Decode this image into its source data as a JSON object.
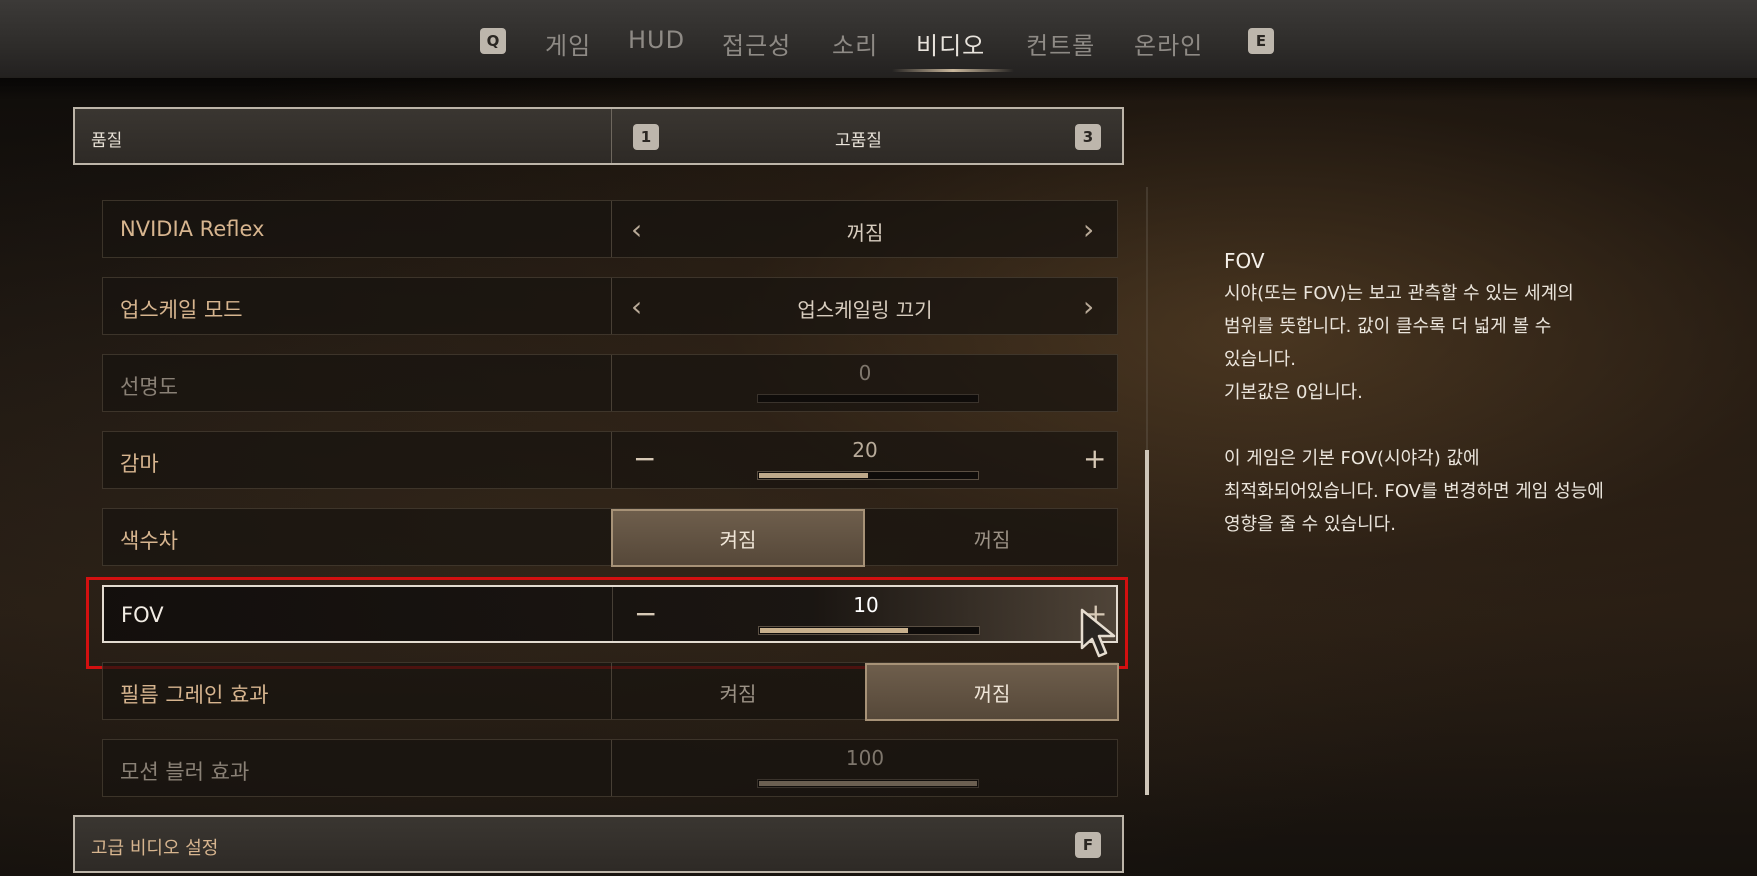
{
  "nav": {
    "prev_key": "Q",
    "next_key": "E",
    "tabs": [
      "게임",
      "HUD",
      "접근성",
      "소리",
      "비디오",
      "컨트롤",
      "온라인"
    ],
    "active_tab": "비디오"
  },
  "quality": {
    "label": "품질",
    "dec_key": "1",
    "value": "고품질",
    "inc_key": "3"
  },
  "settings": [
    {
      "label": "NVIDIA Reflex",
      "type": "selector",
      "value": "꺼짐"
    },
    {
      "label": "업스케일 모드",
      "type": "selector",
      "value": "업스케일링 끄기"
    },
    {
      "label": "선명도",
      "type": "slider",
      "value": "0",
      "fill": 0.0,
      "enabled": false
    },
    {
      "label": "감마",
      "type": "slider",
      "value": "20",
      "fill": 0.5,
      "enabled": true
    },
    {
      "label": "색수차",
      "type": "toggle",
      "on_label": "켜짐",
      "off_label": "꺼짐",
      "selected": "켜짐"
    },
    {
      "label": "FOV",
      "type": "slider",
      "value": "10",
      "fill": 0.68,
      "enabled": true,
      "focused": true
    },
    {
      "label": "필름 그레인 효과",
      "type": "toggle",
      "on_label": "켜짐",
      "off_label": "꺼짐",
      "selected": "꺼짐"
    },
    {
      "label": "모션 블러 효과",
      "type": "slider",
      "value": "100",
      "fill": 1.0,
      "enabled": false
    }
  ],
  "slider_symbols": {
    "minus": "−",
    "plus": "+"
  },
  "arrows": {
    "left": "‹",
    "right": "›"
  },
  "advanced": {
    "label": "고급 비디오 설정",
    "key": "F"
  },
  "description": {
    "title": "FOV",
    "p1_lines": [
      "시야(또는 FOV)는 보고 관측할 수 있는 세계의",
      "범위를 뜻합니다. 값이 클수록 더 넓게 볼 수",
      "있습니다.",
      "기본값은 0입니다."
    ],
    "p2_lines": [
      "이 게임은 기본 FOV(시야각) 값에",
      "최적화되어있습니다. FOV를 변경하면 게임 성능에",
      "영향을 줄 수 있습니다."
    ]
  },
  "colors": {
    "highlight": "#d31010",
    "label": "#d7b58f",
    "accent": "#bfa98a"
  }
}
